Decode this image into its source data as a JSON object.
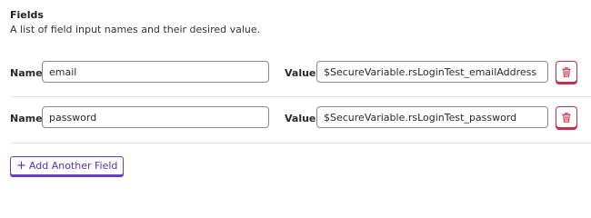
{
  "section": {
    "title": "Fields",
    "description": "A list of field input names and their desired value."
  },
  "fields": [
    {
      "name_label": "Name",
      "name_value": "email",
      "value_label": "Value",
      "value_value": "$SecureVariable.rsLoginTest_emailAddress",
      "delete_icon": "trash-icon"
    },
    {
      "name_label": "Name",
      "name_value": "password",
      "value_label": "Value",
      "value_value": "$SecureVariable.rsLoginTest_password",
      "delete_icon": "trash-icon"
    }
  ],
  "add_button": {
    "icon": "+",
    "label": "Add Another Field"
  },
  "colors": {
    "delete_accent": "#c23048",
    "add_accent": "#6a3cc9",
    "input_border": "#8a8a8a",
    "divider": "#e3e3e3"
  }
}
